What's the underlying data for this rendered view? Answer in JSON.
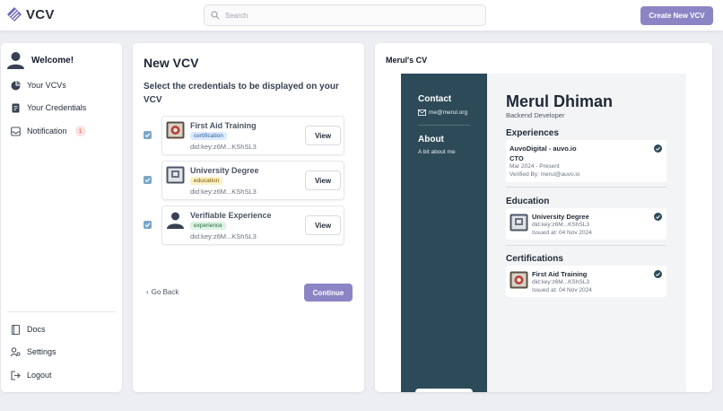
{
  "app": {
    "name": "VCV"
  },
  "header": {
    "search_placeholder": "Search",
    "create_label": "Create New VCV"
  },
  "sidebar": {
    "welcome": "Welcome!",
    "items": [
      {
        "label": "Your VCVs",
        "icon": "pie-chart-icon"
      },
      {
        "label": "Your Credentials",
        "icon": "document-icon"
      },
      {
        "label": "Notification",
        "icon": "inbox-icon",
        "badge": "1"
      }
    ],
    "bottom": [
      {
        "label": "Docs",
        "icon": "book-icon"
      },
      {
        "label": "Settings",
        "icon": "settings-icon"
      },
      {
        "label": "Logout",
        "icon": "logout-icon"
      }
    ]
  },
  "new_vcv": {
    "title": "New VCV",
    "subtitle": "Select the credentials to be displayed on your VCV",
    "credentials": [
      {
        "name": "First Aid Training",
        "tag": "certification",
        "did": "did:key:z6M...KShSL3",
        "checked": true,
        "view": "View"
      },
      {
        "name": "University Degree",
        "tag": "education",
        "did": "did:key:z6M...KShSL3",
        "checked": true,
        "view": "View"
      },
      {
        "name": "Verifiable Experience",
        "tag": "experience",
        "did": "did:key:z6M...KShSL3",
        "checked": true,
        "view": "View"
      }
    ],
    "back_label": "Go Back",
    "continue_label": "Continue"
  },
  "cv": {
    "title": "Merul's CV",
    "contact_heading": "Contact",
    "email": "me@merul.org",
    "about_heading": "About",
    "about_text": "A bit about me",
    "name": "Merul Dhiman",
    "role": "Backend Developer",
    "experiences_heading": "Experiences",
    "experience": {
      "company": "AuvoDigital - auvo.io",
      "position": "CTO",
      "dates": "Mar 2024 - Present",
      "verified": "Verified By: merul@auvo.io"
    },
    "education_heading": "Education",
    "education": {
      "name": "University Degree",
      "did": "did:key:z6M...KShSL3",
      "issued": "Issued at: 04 Nov 2024"
    },
    "certifications_heading": "Certifications",
    "certification": {
      "name": "First Aid Training",
      "did": "did:key:z6M...KShSL3",
      "issued": "Issued at: 04 Nov 2024"
    }
  },
  "colors": {
    "accent": "#8b85c5",
    "cv_sidebar": "#2d4a58",
    "checkbox": "#7aa6c4"
  }
}
